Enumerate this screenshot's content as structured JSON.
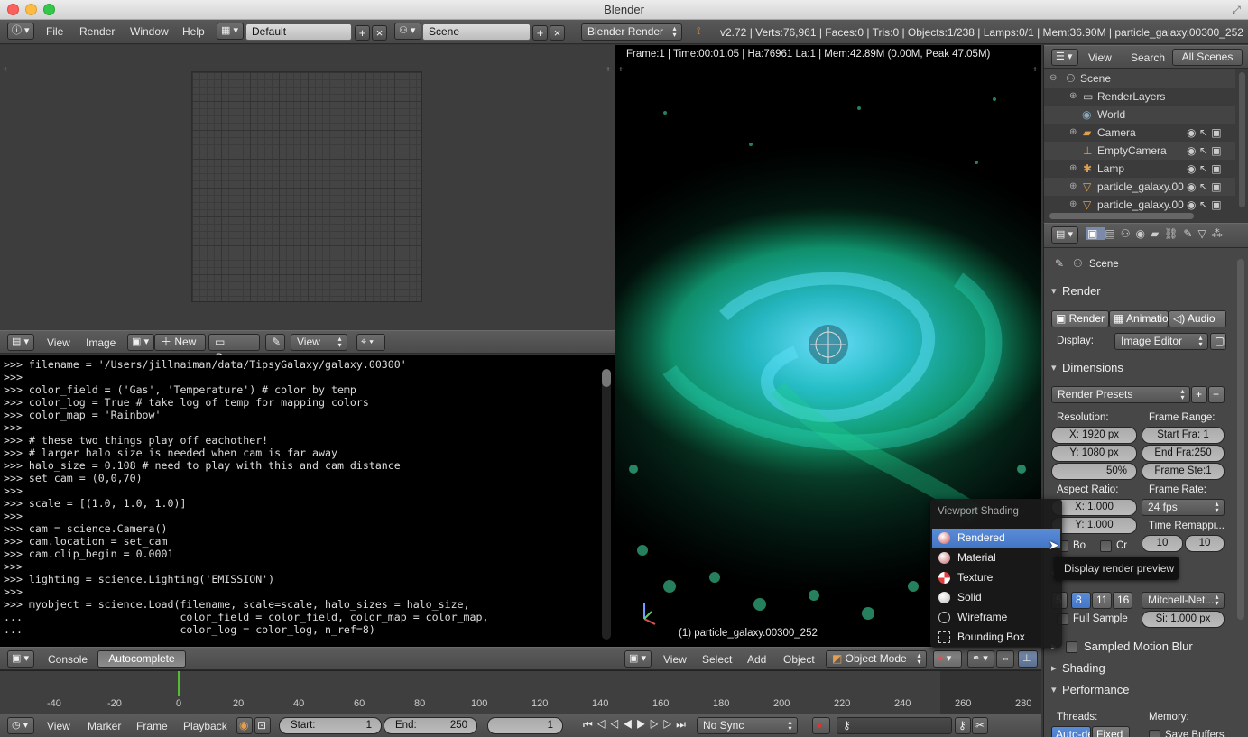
{
  "window": {
    "title": "Blender"
  },
  "info_header": {
    "menus": [
      "File",
      "Render",
      "Window",
      "Help"
    ],
    "screen_layout": "Default",
    "scene": "Scene",
    "render_engine": "Blender Render",
    "stats": "v2.72 | Verts:76,961 | Faces:0 | Tris:0 | Objects:1/238 | Lamps:0/1 | Mem:36.90M | particle_galaxy.00300_252"
  },
  "image_editor_header": {
    "view": "View",
    "image": "Image",
    "new": "New",
    "open": "Open",
    "view_dropdown": "View"
  },
  "console": {
    "lines": [
      ">>> filename = '/Users/jillnaiman/data/TipsyGalaxy/galaxy.00300'",
      ">>>",
      ">>> color_field = ('Gas', 'Temperature') # color by temp",
      ">>> color_log = True # take log of temp for mapping colors",
      ">>> color_map = 'Rainbow'",
      ">>>",
      ">>> # these two things play off eachother!",
      ">>> # larger halo size is needed when cam is far away",
      ">>> halo_size = 0.108 # need to play with this and cam distance",
      ">>> set_cam = (0,0,70)",
      ">>>",
      ">>> scale = [(1.0, 1.0, 1.0)]",
      ">>>",
      ">>> cam = science.Camera()",
      ">>> cam.location = set_cam",
      ">>> cam.clip_begin = 0.0001",
      ">>>",
      ">>> lighting = science.Lighting('EMISSION')",
      ">>>",
      ">>> myobject = science.Load(filename, scale=scale, halo_sizes = halo_size,",
      "...                         color_field = color_field, color_map = color_map,",
      "...                         color_log = color_log, n_ref=8)"
    ],
    "header": {
      "console": "Console",
      "autocomplete": "Autocomplete"
    }
  },
  "viewport": {
    "render_info": "Frame:1 | Time:00:01.05 | Ha:76961 La:1 | Mem:42.89M (0.00M, Peak 47.05M)",
    "object_label": "(1) particle_galaxy.00300_252",
    "header": {
      "view": "View",
      "select": "Select",
      "add": "Add",
      "object": "Object",
      "mode": "Object Mode"
    }
  },
  "shading_menu": {
    "title": "Viewport Shading",
    "items": [
      {
        "label": "Rendered",
        "active": true
      },
      {
        "label": "Material",
        "active": false
      },
      {
        "label": "Texture",
        "active": false
      },
      {
        "label": "Solid",
        "active": false
      },
      {
        "label": "Wireframe",
        "active": false
      },
      {
        "label": "Bounding Box",
        "active": false
      }
    ],
    "tooltip": "Display render preview"
  },
  "outliner": {
    "header": {
      "view": "View",
      "search": "Search",
      "all_scenes": "All Scenes"
    },
    "rows": [
      "Scene",
      "RenderLayers",
      "World",
      "Camera",
      "EmptyCamera",
      "Lamp",
      "particle_galaxy.00",
      "particle_galaxy.00"
    ]
  },
  "properties": {
    "breadcrumb": "Scene",
    "render_panel": {
      "title": "Render",
      "render_btn": "Render",
      "animation_btn": "Animatio",
      "audio_btn": "Audio",
      "display_label": "Display:",
      "display_value": "Image Editor"
    },
    "dimensions_panel": {
      "title": "Dimensions",
      "presets": "Render Presets",
      "resolution_label": "Resolution:",
      "res_x": "X:  1920 px",
      "res_y": "Y:  1080 px",
      "res_pct": "50%",
      "frame_range_label": "Frame Range:",
      "start": "Start Fra:  1",
      "end": "End Fra:250",
      "step": "Frame Ste:1",
      "aspect_label": "Aspect Ratio:",
      "aspect_x": "X:    1.000",
      "aspect_y": "Y:    1.000",
      "frame_rate_label": "Frame Rate:",
      "fps": "24 fps",
      "time_remap_label": "Time Remappi...",
      "remap_old": "10",
      "remap_new": "10",
      "border": "Bo",
      "crop": "Cr"
    },
    "aa_panel": {
      "samples": [
        "5",
        "8",
        "11",
        "16"
      ],
      "filter": "Mitchell-Net...",
      "full_sample": "Full Sample",
      "size": "Si: 1.000 px"
    },
    "motion_blur": "Sampled Motion Blur",
    "shading": "Shading",
    "performance": "Performance",
    "threads_label": "Threads:",
    "memory_label": "Memory:",
    "auto_detect": "Auto-det",
    "fixed": "Fixed",
    "save_buffers": "Save Buffers"
  },
  "timeline": {
    "ticks": [
      "-40",
      "-20",
      "0",
      "20",
      "40",
      "60",
      "80",
      "100",
      "120",
      "140",
      "160",
      "180",
      "200",
      "220",
      "240",
      "260",
      "280"
    ],
    "current_frame": "1",
    "menus": [
      "View",
      "Marker",
      "Frame",
      "Playback"
    ],
    "start_label": "Start:",
    "start_value": "1",
    "end_label": "End:",
    "end_value": "250",
    "sync": "No Sync"
  },
  "colors": {
    "menu_active": "#4a7ccc",
    "render_blue": "#5ab0d6",
    "frame_marker": "#55bb33"
  }
}
